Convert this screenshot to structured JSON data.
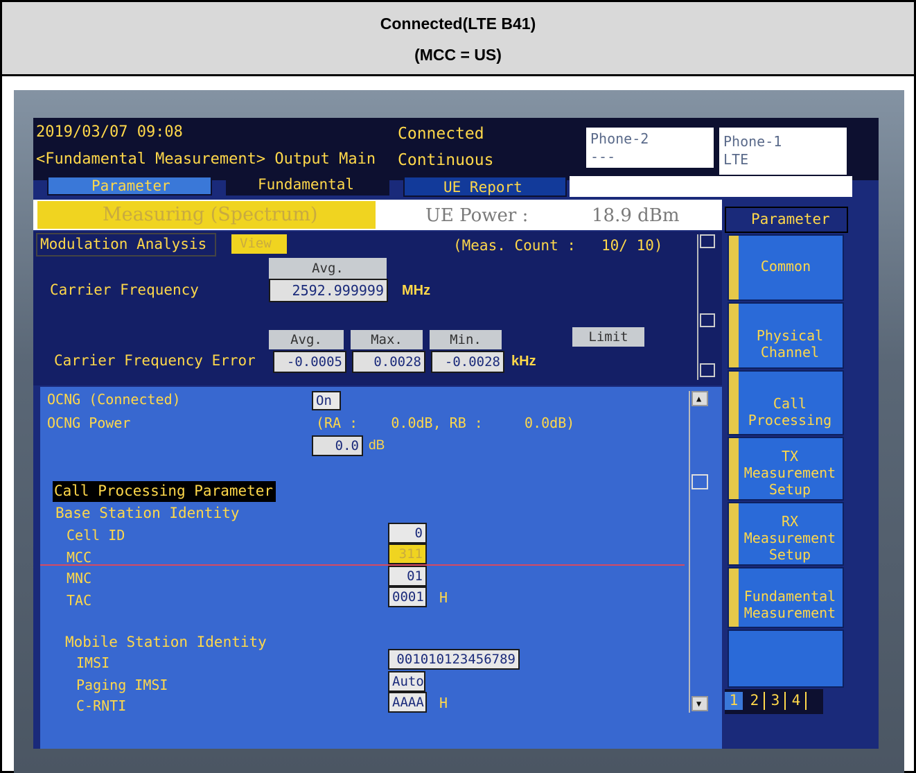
{
  "header": {
    "line1": "Connected(LTE B41)",
    "line2": "(MCC = US)"
  },
  "status": {
    "datetime": "2019/03/07 09:08",
    "mode": "<Fundamental Measurement> Output Main",
    "connection": "Connected",
    "run": "Continuous",
    "phone2_title": "Phone-2",
    "phone2_value": "---",
    "phone1_title": "Phone-1",
    "phone1_value": "LTE"
  },
  "tabs": [
    "Parameter",
    "Fundamental",
    "UE Report"
  ],
  "measure": {
    "state": "Measuring (Spectrum)",
    "ue_power_label": "UE Power :",
    "ue_power_value": "18.9 dBm"
  },
  "modulation": {
    "title": "Modulation Analysis",
    "view": "View",
    "count_label": "(Meas. Count :",
    "count_value": "10/  10)",
    "avg_label": "Avg.",
    "carrier_freq_label": "Carrier Frequency",
    "carrier_freq_value": "2592.999999",
    "carrier_freq_unit": "MHz",
    "col_avg": "Avg.",
    "col_max": "Max.",
    "col_min": "Min.",
    "limit": "Limit",
    "err_label": "Carrier Frequency Error",
    "err_avg": "-0.0005",
    "err_max": "0.0028",
    "err_min": "-0.0028",
    "err_unit": "kHz"
  },
  "params": {
    "ocng_label": "OCNG (Connected)",
    "ocng_value": "On",
    "ocng_power_label": "OCNG Power",
    "ocng_power_ra": "(RA :    0.0dB, RB :     0.0dB)",
    "ocng_power_value": "0.0",
    "ocng_power_unit": "dB",
    "cpp_title": "Call Processing Parameter",
    "bsi": "Base Station Identity",
    "cell_id_label": "Cell ID",
    "cell_id_value": "0",
    "mcc_label": "MCC",
    "mcc_value": "311",
    "mnc_label": "MNC",
    "mnc_value": "01",
    "tac_label": "TAC",
    "tac_value": "0001",
    "tac_unit": "H",
    "msi": "Mobile Station Identity",
    "imsi_label": "IMSI",
    "imsi_value": "001010123456789",
    "paging_label": "Paging IMSI",
    "paging_value": "Auto",
    "crnti_label": "C-RNTI",
    "crnti_value": "AAAA",
    "crnti_unit": "H"
  },
  "sidebar": {
    "title": "Parameter",
    "items": [
      "Common",
      "Physical Channel",
      "Call Processing",
      "TX Measurement Setup",
      "RX Measurement Setup",
      "Fundamental Measurement",
      ""
    ],
    "pages": [
      "1",
      "2",
      "3",
      "4"
    ]
  }
}
